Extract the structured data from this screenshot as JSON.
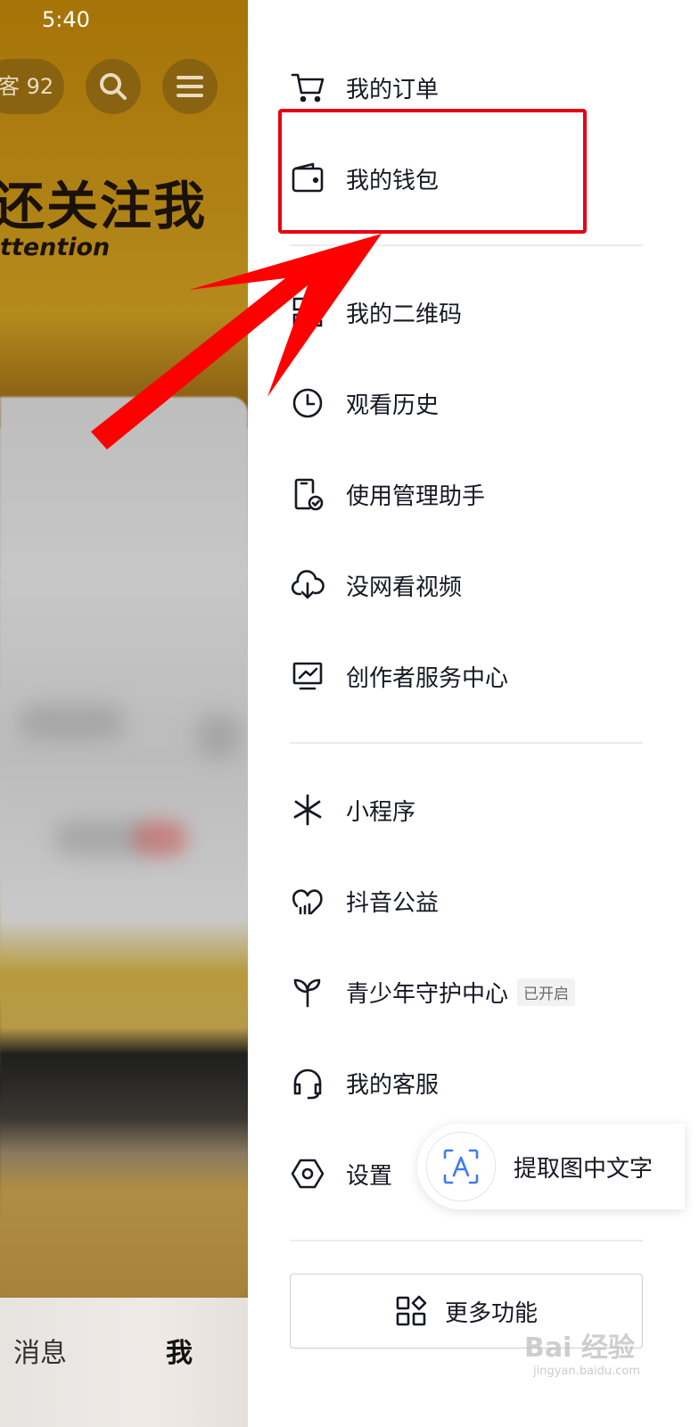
{
  "status_bar": {
    "time": "5:40"
  },
  "profile_header": {
    "visitor_label": "客 92",
    "banner_text": "还关注我",
    "banner_subtext": "ttention"
  },
  "bottom_tabs": [
    {
      "label": "消息"
    },
    {
      "label": "我"
    }
  ],
  "drawer": {
    "items": [
      {
        "label": "我的订单",
        "icon": "cart-icon"
      },
      {
        "label": "我的钱包",
        "icon": "wallet-icon",
        "highlighted": true
      },
      {
        "label": "我的二维码",
        "icon": "qr-code-icon"
      },
      {
        "label": "观看历史",
        "icon": "clock-icon"
      },
      {
        "label": "使用管理助手",
        "icon": "phone-check-icon"
      },
      {
        "label": "没网看视频",
        "icon": "cloud-download-icon"
      },
      {
        "label": "创作者服务中心",
        "icon": "monitor-chart-icon"
      },
      {
        "label": "小程序",
        "icon": "asterisk-icon"
      },
      {
        "label": "抖音公益",
        "icon": "heart-chart-icon"
      },
      {
        "label": "青少年守护中心",
        "icon": "sprout-icon",
        "badge": "已开启"
      },
      {
        "label": "我的客服",
        "icon": "headset-icon"
      },
      {
        "label": "设置",
        "icon": "hexagon-settings-icon"
      }
    ],
    "more_button": "更多功能"
  },
  "ocr_float": {
    "label": "提取图中文字",
    "icon": "text-scan-icon"
  },
  "watermark": {
    "text": "Bai 经验",
    "sub": "jingyan.baidu.com"
  },
  "colors": {
    "highlight": "#e60012",
    "arrow": "#ff0000",
    "text": "#161823"
  }
}
